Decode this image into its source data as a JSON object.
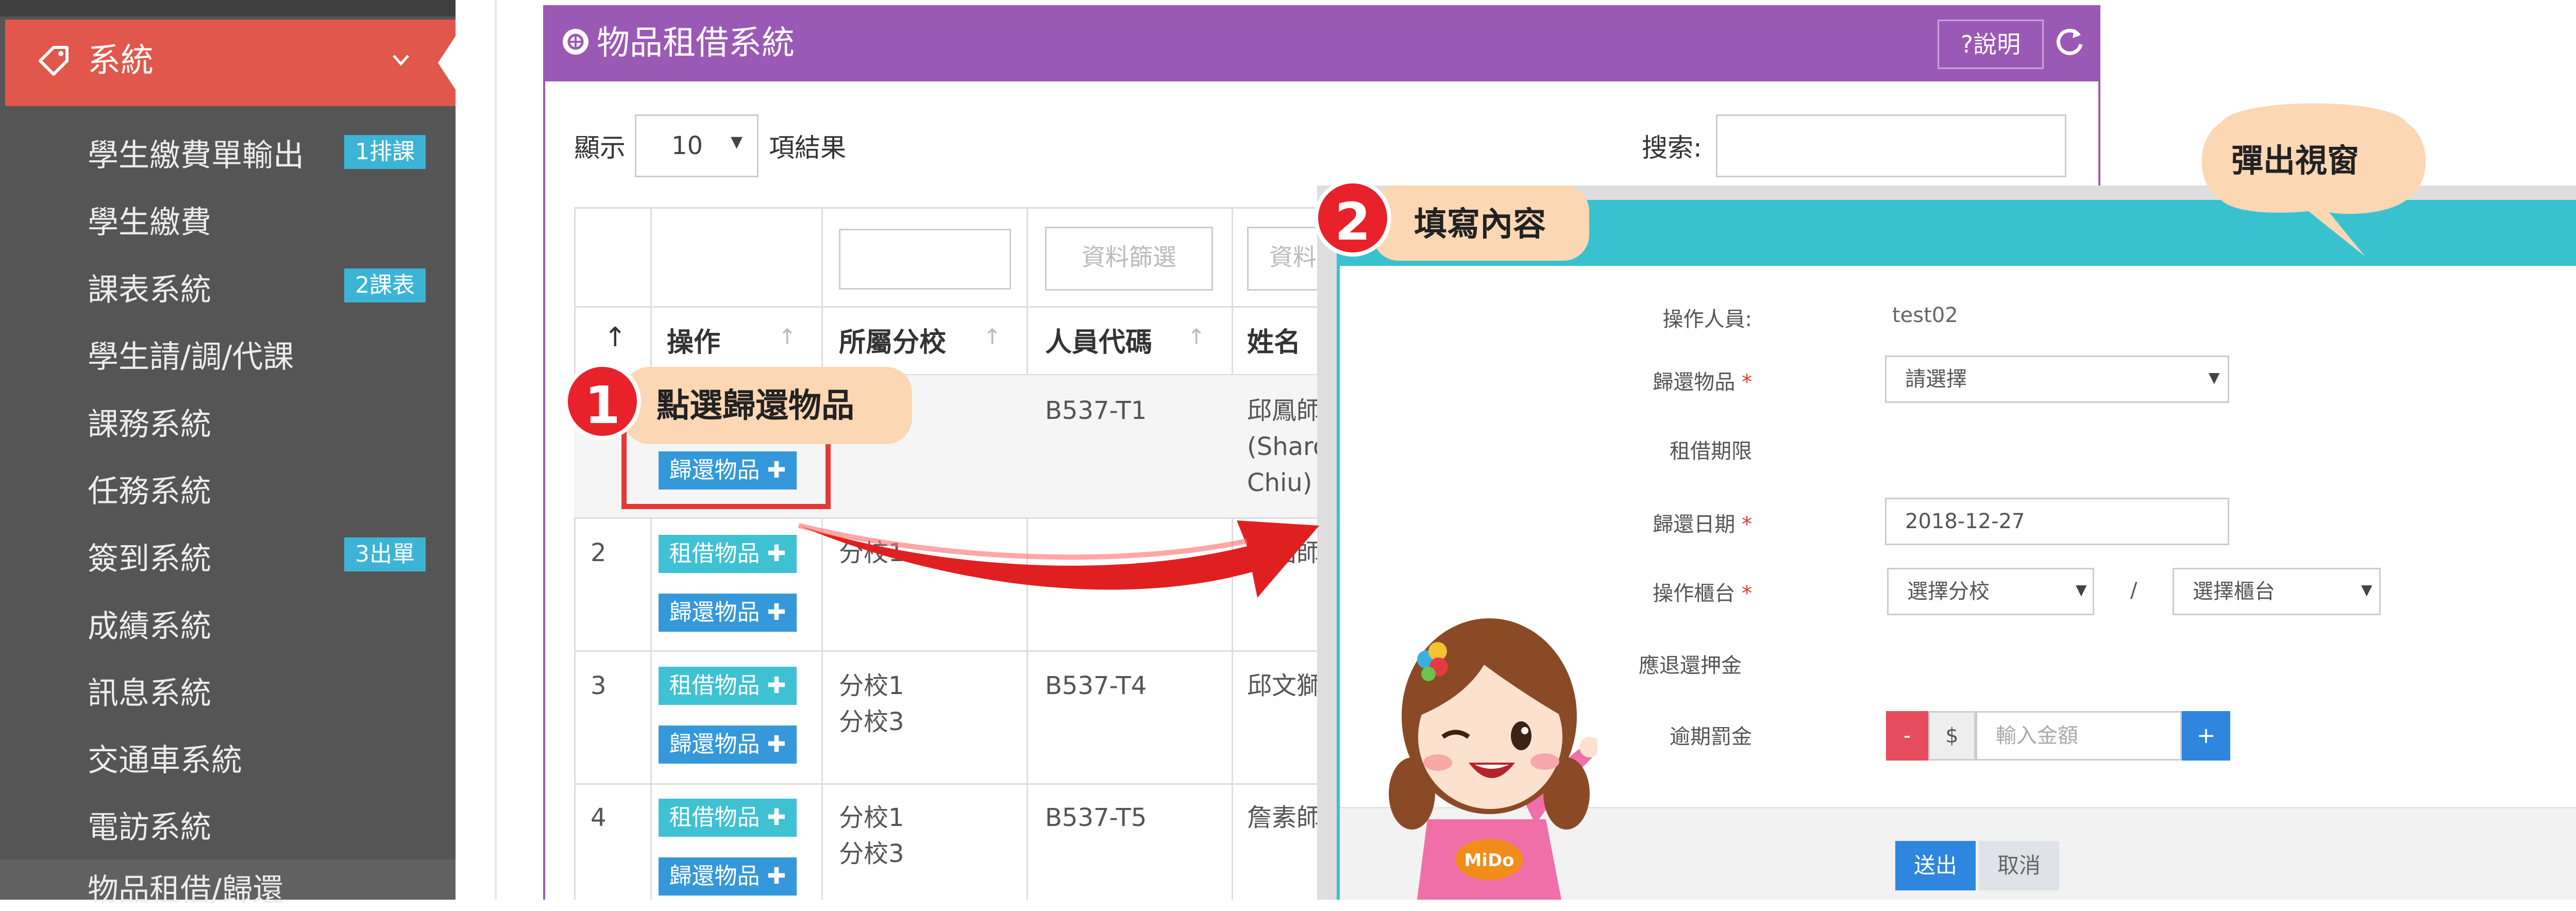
{
  "sidebar": {
    "active_label": "系統",
    "active_icon": "tag-icon",
    "items": [
      {
        "label": "學生繳費單輸出",
        "badge": "1排課"
      },
      {
        "label": "學生繳費",
        "badge": ""
      },
      {
        "label": "課表系統",
        "badge": "2課表"
      },
      {
        "label": "學生請/調/代課",
        "badge": ""
      },
      {
        "label": "課務系統",
        "badge": ""
      },
      {
        "label": "任務系統",
        "badge": ""
      },
      {
        "label": "簽到系統",
        "badge": "3出單"
      },
      {
        "label": "成績系統",
        "badge": ""
      },
      {
        "label": "訊息系統",
        "badge": ""
      },
      {
        "label": "交通車系統",
        "badge": ""
      },
      {
        "label": "電訪系統",
        "badge": ""
      },
      {
        "label": "物品租借/歸還",
        "badge": ""
      }
    ]
  },
  "panel": {
    "title": "物品租借系統",
    "help_label": "?說明",
    "show_label": "顯示",
    "page_length": "10",
    "results_label": "項結果",
    "search_label": "搜索:"
  },
  "table": {
    "filter_button": "資料篩選",
    "filter_button_partial": "資料",
    "headers": {
      "index": "↑",
      "action": "操作",
      "branch": "所屬分校",
      "code": "人員代碼",
      "name": "姓名"
    },
    "borrow_button": "租借物品",
    "return_button": "歸還物品",
    "rows": [
      {
        "index": "",
        "branch_lines": [],
        "code": "B537-T1",
        "name_lines": [
          "邱鳳師",
          "(Sharo",
          "Chiu)"
        ]
      },
      {
        "index": "2",
        "branch_lines": [
          "分校1"
        ],
        "code": "",
        "name_lines": [
          "劉昭師"
        ]
      },
      {
        "index": "3",
        "branch_lines": [
          "分校1",
          "分校3"
        ],
        "code": "B537-T4",
        "name_lines": [
          "邱文獅"
        ]
      },
      {
        "index": "4",
        "branch_lines": [
          "分校1",
          "分校3"
        ],
        "code": "B537-T5",
        "name_lines": [
          "詹素師"
        ]
      }
    ]
  },
  "annotations": {
    "step1_number": "1",
    "step1_text": "點選歸還物品",
    "step2_number": "2",
    "step2_text": "填寫內容",
    "popup_bubble": "彈出視窗",
    "mascot_name": "MiDo"
  },
  "popup": {
    "operator_label": "操作人員:",
    "operator_value": "test02",
    "return_item_label": "歸還物品",
    "return_item_placeholder": "請選擇",
    "rental_period_label": "租借期限",
    "return_date_label": "歸還日期",
    "return_date_value": "2018-12-27",
    "counter_label": "操作櫃台",
    "branch_placeholder": "選擇分校",
    "separator": "/",
    "counter_placeholder": "選擇櫃台",
    "deposit_label": "應退還押金",
    "late_fee_label": "逾期罰金",
    "minus_label": "-",
    "currency_label": "$",
    "amount_placeholder": "輸入金額",
    "plus_label": "+",
    "required_mark": "*",
    "submit_label": "送出",
    "cancel_label": "取消"
  },
  "colors": {
    "sidebar_bg": "#555555",
    "sidebar_active": "#e2574b",
    "panel_header": "#9b59b6",
    "popup_header": "#38c2d0",
    "borrow_button": "#3ec1d3",
    "return_button": "#3498db",
    "callout_fill": "#fbd7b4",
    "callout_number": "#e8222a"
  }
}
